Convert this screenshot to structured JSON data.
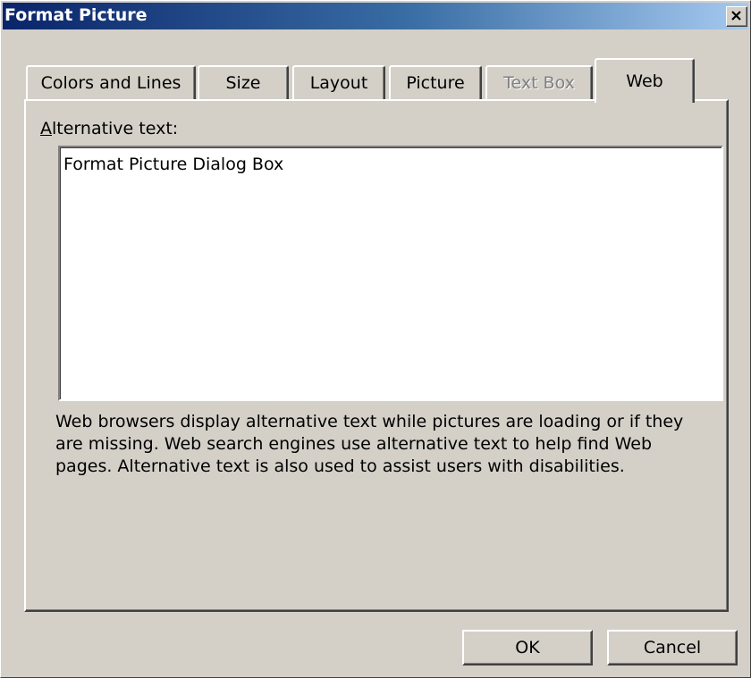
{
  "window": {
    "title": "Format Picture",
    "close_icon": "close-icon"
  },
  "tabs": [
    {
      "label": "Colors and Lines",
      "state": "inactive"
    },
    {
      "label": "Size",
      "state": "inactive"
    },
    {
      "label": "Layout",
      "state": "inactive"
    },
    {
      "label": "Picture",
      "state": "inactive"
    },
    {
      "label": "Text Box",
      "state": "disabled"
    },
    {
      "label": "Web",
      "state": "active"
    }
  ],
  "web_tab": {
    "alt_label_mnemonic": "A",
    "alt_label_rest": "lternative text:",
    "alt_text_value": "Format Picture Dialog Box",
    "help_text": "Web browsers display alternative text while pictures are loading or if they are missing.   Web search engines use alternative text to help find Web pages.  Alternative text is also used to assist users with disabilities."
  },
  "buttons": {
    "ok_label": "OK",
    "cancel_label": "Cancel"
  },
  "colors": {
    "face": "#d4d0c8",
    "title_start": "#0a246a",
    "title_end": "#a6caf0",
    "disabled_text": "#808080"
  }
}
